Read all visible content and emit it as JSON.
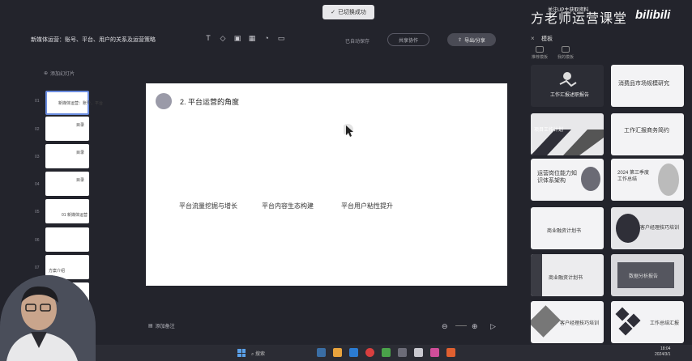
{
  "toast": {
    "text": "已切换成功"
  },
  "header": {
    "doc_title": "新媒体运营：账号、平台、用户的关系及运营策略",
    "save_status": "已自动保存",
    "share_label": "共享协作",
    "export_label": "导出/分享"
  },
  "watermark": {
    "brand": "方老师运营课堂",
    "sub": "关注UP主获取资料",
    "logo": "bilibili"
  },
  "toolbar": {
    "icons": [
      "text-icon",
      "shape-icon",
      "image-icon",
      "table-icon",
      "chart-icon",
      "media-icon"
    ],
    "glyphs": [
      "T",
      "◇",
      "▣",
      "▦",
      "◔",
      "▭"
    ]
  },
  "left_panel": {
    "header": "添加幻灯片",
    "thumbs": [
      {
        "num": "01",
        "text": "新媒体运营：账号、平台"
      },
      {
        "num": "02",
        "text": "目录"
      },
      {
        "num": "03",
        "text": "目录"
      },
      {
        "num": "04",
        "text": "目录"
      },
      {
        "num": "05",
        "text": "01 新媒体运营"
      },
      {
        "num": "06",
        "text": ""
      },
      {
        "num": "07",
        "text": "方案介绍"
      },
      {
        "num": "08",
        "text": ""
      }
    ]
  },
  "slide": {
    "title": "2. 平台运营的角度",
    "items": [
      "平台流量挖掘与增长",
      "平台内容生态构建",
      "平台用户粘性提升"
    ]
  },
  "right_panel": {
    "title": "模板",
    "tabs": [
      "推荐模板",
      "我的模板"
    ],
    "templates": [
      {
        "title": "工作汇报述职报告"
      },
      {
        "title": "消费品市场规模研究"
      },
      {
        "title": "项目工作计划"
      },
      {
        "title": "工作汇报商务简约"
      },
      {
        "title": "运营岗位能力知识体系架构"
      },
      {
        "title": "2024 第三季度工作总结"
      },
      {
        "title": "商业融资计划书"
      },
      {
        "title": "客户经理技巧培训"
      },
      {
        "title": "商业融资计划书"
      },
      {
        "title": "数据分析报告"
      },
      {
        "title": "客户经理技巧培训"
      },
      {
        "title": "工作总结汇报"
      }
    ]
  },
  "bottom": {
    "notes_label": "添加备注"
  },
  "taskbar": {
    "search": "搜索",
    "time": "18:04",
    "date": "2024/3/1"
  }
}
